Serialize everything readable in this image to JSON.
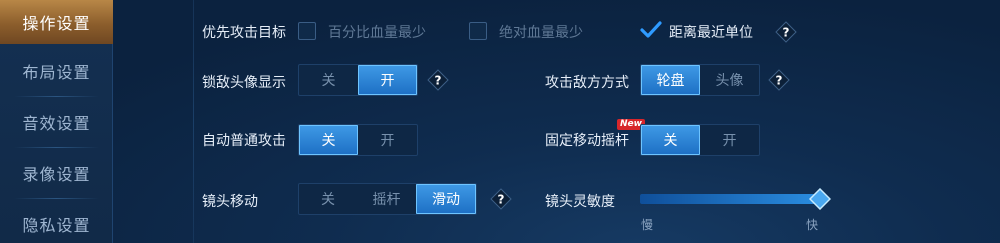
{
  "sidebar": {
    "items": [
      {
        "label": "操作设置",
        "active": true
      },
      {
        "label": "布局设置"
      },
      {
        "label": "音效设置"
      },
      {
        "label": "录像设置"
      },
      {
        "label": "隐私设置"
      }
    ]
  },
  "priority": {
    "label": "优先攻击目标",
    "options": [
      {
        "label": "百分比血量最少",
        "checked": false
      },
      {
        "label": "绝对血量最少",
        "checked": false
      },
      {
        "label": "距离最近单位",
        "checked": true
      }
    ]
  },
  "lock_avatar": {
    "label": "锁敌头像显示",
    "options": [
      "关",
      "开"
    ],
    "selected": "开"
  },
  "attack_mode": {
    "label": "攻击敌方方式",
    "options": [
      "轮盘",
      "头像"
    ],
    "selected": "轮盘"
  },
  "auto_attack": {
    "label": "自动普通攻击",
    "options": [
      "关",
      "开"
    ],
    "selected": "关"
  },
  "fixed_joystick": {
    "label": "固定移动摇杆",
    "badge": "New",
    "options": [
      "关",
      "开"
    ],
    "selected": "关"
  },
  "camera_move": {
    "label": "镜头移动",
    "options": [
      "关",
      "摇杆",
      "滑动"
    ],
    "selected": "滑动"
  },
  "camera_sensitivity": {
    "label": "镜头灵敏度",
    "min_label": "慢",
    "max_label": "快",
    "value": 1.0
  },
  "help_icon": "question-mark-diamond-icon",
  "colors": {
    "accent": "#2a8de0",
    "active_tab": "#a7773d",
    "check": "#2f9bff"
  }
}
